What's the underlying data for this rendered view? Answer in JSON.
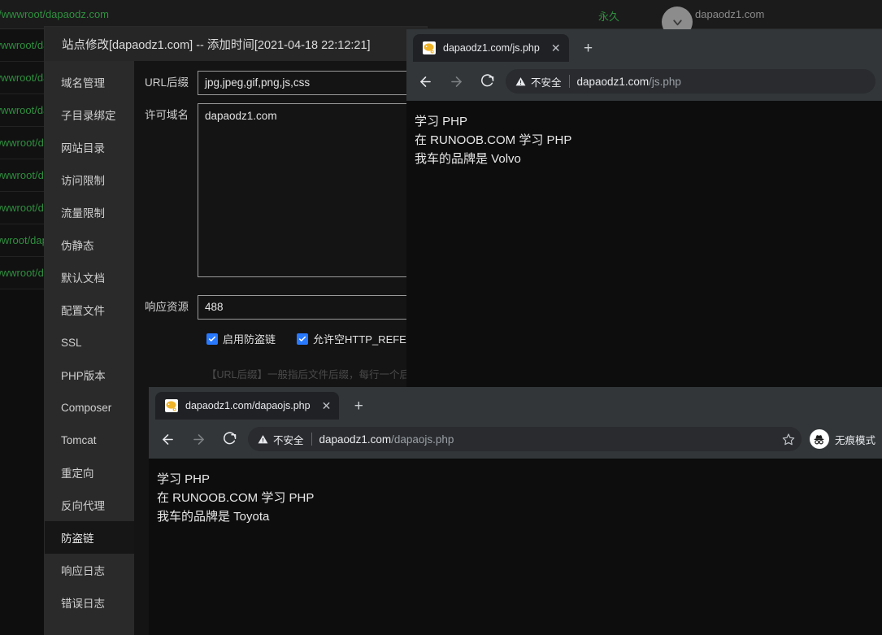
{
  "bt_panel": {
    "top_path": "www/wwwroot/dapaodz.com",
    "permanent_label": "永久",
    "top_domain": "dapaodz1.com",
    "expand_icon": "chevron-down-icon",
    "rows": [
      "me/wwwroot/dapaodz.com",
      "me/wwwroot/dapaodz.com",
      "me/wwwroot/dapaodz.com",
      "ww/wwwroot/dapaodz.com",
      "ww/wwwroot/dapaodz.com",
      "ww/wwwroot/dapaodz.com",
      "w/wwwroot/dapaodz.com",
      "ww/wwwroot/dapaodz.com"
    ]
  },
  "modal": {
    "title": "站点修改[dapaodz1.com] -- 添加时间[2021-04-18 22:12:21]",
    "sidebar": [
      {
        "label": "域名管理",
        "active": false
      },
      {
        "label": "子目录绑定",
        "active": false
      },
      {
        "label": "网站目录",
        "active": false
      },
      {
        "label": "访问限制",
        "active": false
      },
      {
        "label": "流量限制",
        "active": false
      },
      {
        "label": "伪静态",
        "active": false
      },
      {
        "label": "默认文档",
        "active": false
      },
      {
        "label": "配置文件",
        "active": false
      },
      {
        "label": "SSL",
        "active": false
      },
      {
        "label": "PHP版本",
        "active": false
      },
      {
        "label": "Composer",
        "active": false
      },
      {
        "label": "Tomcat",
        "active": false
      },
      {
        "label": "重定向",
        "active": false
      },
      {
        "label": "反向代理",
        "active": false
      },
      {
        "label": "防盗链",
        "active": true
      },
      {
        "label": "响应日志",
        "active": false
      },
      {
        "label": "错误日志",
        "active": false
      }
    ],
    "form": {
      "url_suffix_label": "URL后缀",
      "url_suffix_value": "jpg,jpeg,gif,png,js,css",
      "allowed_domain_label": "许可域名",
      "allowed_domain_value": "dapaodz1.com",
      "response_resource_label": "响应资源",
      "response_resource_value": "488",
      "checkbox_enable_label": "启用防盗链",
      "checkbox_enable_checked": true,
      "checkbox_empty_referer_label": "允许空HTTP_REFERER",
      "checkbox_empty_referer_checked": true,
      "hint": "【URL后缀】一般指后文件后缀，每行一个后缀 如:png"
    }
  },
  "chrome_top": {
    "tab_title": "dapaodz1.com/js.php",
    "favicon": "php-elephant-icon",
    "close_glyph": "✕",
    "new_tab_glyph": "+",
    "back_icon": "arrow-left-icon",
    "forward_icon": "arrow-right-icon",
    "reload_icon": "reload-icon",
    "security_label": "不安全",
    "url_domain": "dapaodz1.com",
    "url_path": "/js.php",
    "page_lines": [
      "学习 PHP",
      "在 RUNOOB.COM 学习 PHP",
      "我车的品牌是 Volvo"
    ]
  },
  "chrome_bottom": {
    "tab_title": "dapaodz1.com/dapaojs.php",
    "favicon": "php-elephant-icon",
    "close_glyph": "✕",
    "new_tab_glyph": "+",
    "back_icon": "arrow-left-icon",
    "forward_icon": "arrow-right-icon",
    "reload_icon": "reload-icon",
    "security_label": "不安全",
    "url_domain": "dapaodz1.com",
    "url_path": "/dapaojs.php",
    "bookmark_icon": "star-icon",
    "incognito_label": "无痕模式",
    "incognito_icon": "incognito-hat-icon",
    "page_lines": [
      "学习 PHP",
      "在 RUNOOB.COM 学习 PHP",
      "我车的品牌是 Toyota"
    ]
  },
  "colors": {
    "terminal_green": "#2f8f3f",
    "checkbox_blue": "#2979ff",
    "chrome_chrome": "#323639",
    "chrome_page": "#0d0d0d"
  }
}
